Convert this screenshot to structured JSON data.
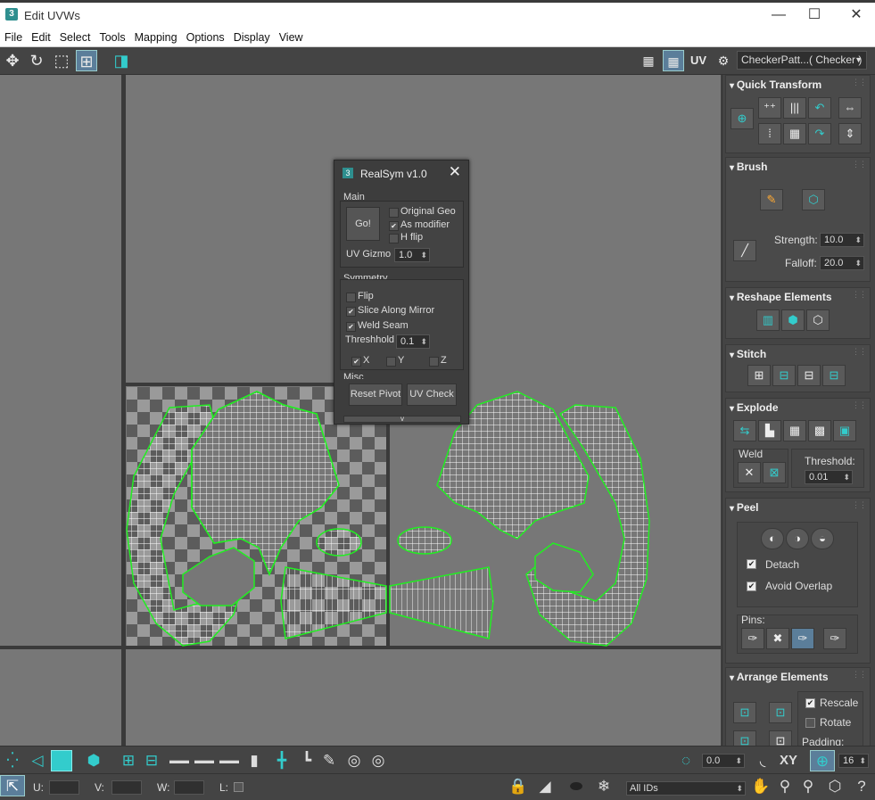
{
  "window": {
    "title": "Edit UVWs",
    "logo": "3",
    "min": "—",
    "max": "☐",
    "close": "✕"
  },
  "menu": [
    "File",
    "Edit",
    "Select",
    "Tools",
    "Mapping",
    "Options",
    "Display",
    "View"
  ],
  "toolbar": {
    "uv_label": "UV",
    "checker": "CheckerPatt...( Checker )",
    "icons": [
      "move-icon",
      "rotate-icon",
      "scale-icon",
      "freeform-icon",
      "mirror-icon"
    ]
  },
  "dialog": {
    "logo": "3",
    "title": "RealSym  v1.0",
    "close": "✕",
    "main": {
      "label": "Main",
      "go": "Go!",
      "original_geo": "Original Geo",
      "as_modifier": "As modifier",
      "h_flip": "H flip",
      "uv_gizmo": "UV Gizmo",
      "uv_gizmo_val": "1.0"
    },
    "symmetry": {
      "label": "Symmetry",
      "flip": "Flip",
      "slice": "Slice Along Mirror",
      "weld": "Weld Seam",
      "threshold": "Threshhold",
      "threshold_val": "0.1",
      "x": "X",
      "y": "Y",
      "z": "Z"
    },
    "misc": {
      "label": "Misc",
      "reset": "Reset Pivot",
      "uvcheck": "UV Check",
      "collapse": "v"
    }
  },
  "panel": {
    "quick_transform": "Quick Transform",
    "brush": {
      "title": "Brush",
      "strength_label": "Strength:",
      "strength": "10.0",
      "falloff_label": "Falloff:",
      "falloff": "20.0"
    },
    "reshape": "Reshape Elements",
    "stitch": "Stitch",
    "explode": {
      "title": "Explode",
      "weld": "Weld",
      "threshold_label": "Threshold:",
      "threshold": "0.01"
    },
    "peel": {
      "title": "Peel",
      "detach": "Detach",
      "avoid": "Avoid Overlap",
      "pins": "Pins:"
    },
    "arrange": {
      "title": "Arrange Elements",
      "rescale": "Rescale",
      "rotate": "Rotate",
      "padding": "Padding:"
    }
  },
  "bottom": {
    "spin_val": "0.0",
    "xy": "XY",
    "count": "16",
    "u": "U:",
    "v": "V:",
    "w": "W:",
    "l": "L:",
    "ids": "All IDs"
  },
  "colors": {
    "accent": "#33cccc",
    "seam": "#22ee22"
  }
}
